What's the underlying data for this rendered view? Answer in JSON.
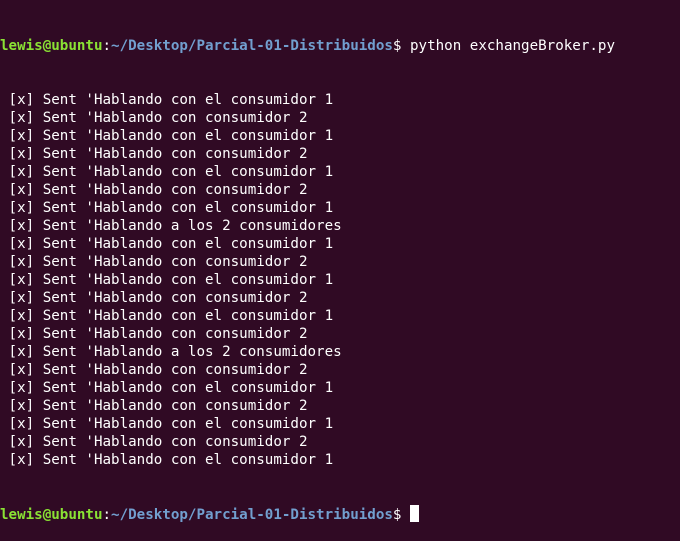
{
  "terminal": {
    "prompt": {
      "user_host": "lewis@ubuntu",
      "separator": ":",
      "path": "~/Desktop/Parcial-01-Distribuidos",
      "dollar": "$ "
    },
    "command": "python exchangeBroker.py",
    "output": [
      " [x] Sent 'Hablando con el consumidor 1",
      " [x] Sent 'Hablando con consumidor 2",
      " [x] Sent 'Hablando con el consumidor 1",
      " [x] Sent 'Hablando con consumidor 2",
      " [x] Sent 'Hablando con el consumidor 1",
      " [x] Sent 'Hablando con consumidor 2",
      " [x] Sent 'Hablando con el consumidor 1",
      " [x] Sent 'Hablando a los 2 consumidores",
      " [x] Sent 'Hablando con el consumidor 1",
      " [x] Sent 'Hablando con consumidor 2",
      " [x] Sent 'Hablando con el consumidor 1",
      " [x] Sent 'Hablando con consumidor 2",
      " [x] Sent 'Hablando con el consumidor 1",
      " [x] Sent 'Hablando con consumidor 2",
      " [x] Sent 'Hablando a los 2 consumidores",
      " [x] Sent 'Hablando con consumidor 2",
      " [x] Sent 'Hablando con el consumidor 1",
      " [x] Sent 'Hablando con consumidor 2",
      " [x] Sent 'Hablando con el consumidor 1",
      " [x] Sent 'Hablando con consumidor 2",
      " [x] Sent 'Hablando con el consumidor 1"
    ]
  },
  "colors": {
    "background": "#300a24",
    "user_host": "#8ae234",
    "path": "#729fcf",
    "text": "#ffffff"
  }
}
